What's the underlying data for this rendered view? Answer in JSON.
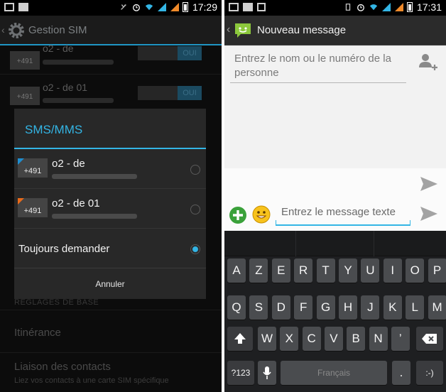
{
  "left_screen": {
    "status_time": "17:29",
    "app_title": "Gestion SIM",
    "background_sims": [
      {
        "name": "o2 - de",
        "chip": "+491",
        "toggle": "OUI"
      },
      {
        "name": "o2 - de 01",
        "chip": "+491",
        "toggle": "OUI"
      }
    ],
    "dialog": {
      "title": "SMS/MMS",
      "options": [
        {
          "name": "o2 - de",
          "chip": "+491",
          "accent": "#1f8ed0",
          "selected": false
        },
        {
          "name": "o2 - de 01",
          "chip": "+491",
          "accent": "#e86a1a",
          "selected": false
        }
      ],
      "always_ask": "Toujours demander",
      "always_ask_selected": true,
      "cancel": "Annuler"
    },
    "section_header": "RÉGLAGES DE BASE",
    "roaming": "Itinérance",
    "contacts_link": "Liaison des contacts",
    "contacts_link_sub": "Liez vos contacts à une carte SIM spécifique"
  },
  "right_screen": {
    "status_time": "17:31",
    "title": "Nouveau message",
    "recipient_placeholder": "Entrez le nom ou le numéro de la personne",
    "message_placeholder": "Entrez le message texte",
    "keyboard": {
      "row1": [
        "A",
        "Z",
        "E",
        "R",
        "T",
        "Y",
        "U",
        "I",
        "O",
        "P"
      ],
      "row2": [
        "Q",
        "S",
        "D",
        "F",
        "G",
        "H",
        "J",
        "K",
        "L",
        "M"
      ],
      "row3": [
        "W",
        "X",
        "C",
        "V",
        "B",
        "N",
        "’"
      ],
      "symbols": "?123",
      "space": "Français",
      "period": ".",
      "smiley": ":-)"
    }
  },
  "colors": {
    "accent": "#33b5e5",
    "sim_blue": "#1f8ed0",
    "sim_orange": "#e86a1a"
  }
}
